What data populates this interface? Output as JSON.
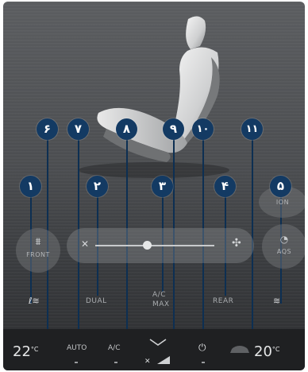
{
  "markers": [
    "١",
    "٢",
    "٣",
    "۴",
    "۵",
    "۶",
    "٧",
    "٨",
    "٩",
    "١٠",
    "١١"
  ],
  "controls": {
    "front_defrost_label": "FRONT",
    "ion_label": "ION",
    "aqs_label": "AQS",
    "dual_label": "DUAL",
    "ac_max_label_line1": "A/C",
    "ac_max_label_line2": "MAX",
    "rear_label": "REAR"
  },
  "bottom_bar": {
    "left_temp": "22",
    "right_temp": "20",
    "temp_unit": "°C",
    "auto_label": "AUTO",
    "ac_label": "A/C"
  },
  "colors": {
    "marker": "#133a63",
    "leader": "#0d2f52"
  }
}
